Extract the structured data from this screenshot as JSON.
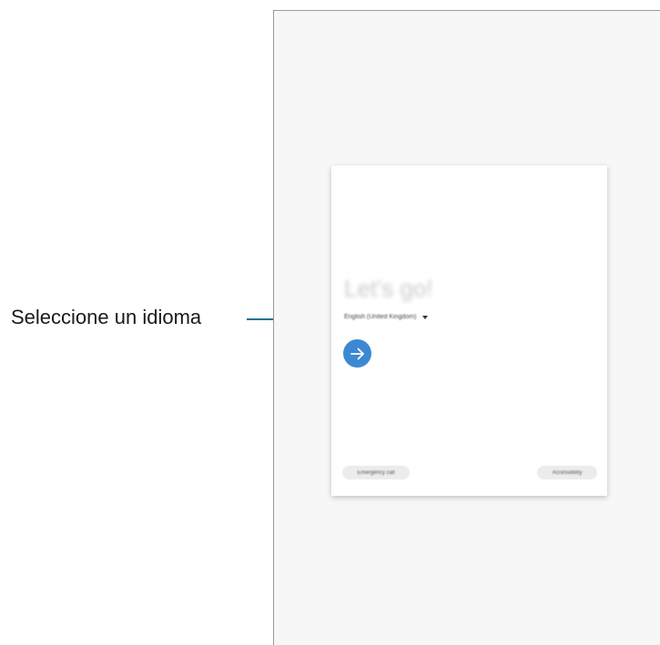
{
  "callout": {
    "label": "Seleccione un idioma"
  },
  "dialog": {
    "title": "Let's go!",
    "language": {
      "selected": "English (United Kingdom)"
    },
    "next_icon": "arrow-right-icon",
    "emergency_label": "Emergency call",
    "accessibility_label": "Accessibility"
  },
  "colors": {
    "accent": "#3d88d2",
    "callout_line": "#1e6f97",
    "frame_border": "#9a9a9a",
    "screen_background": "#f7f7f7"
  }
}
